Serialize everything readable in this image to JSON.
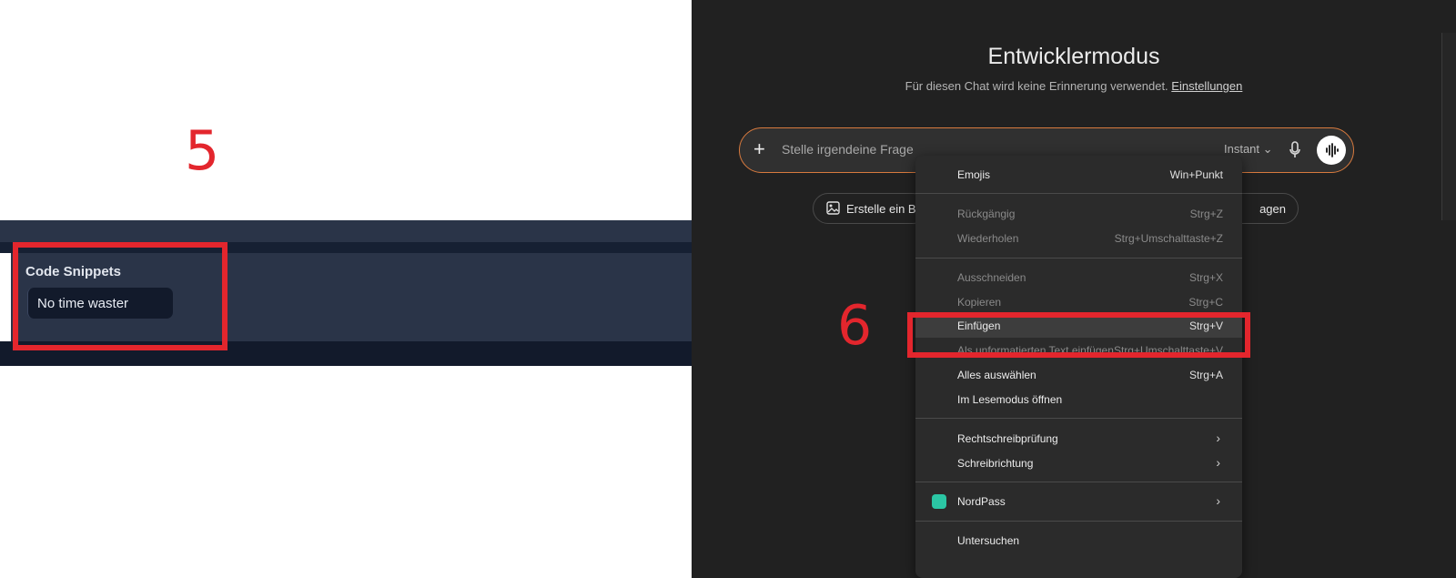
{
  "left": {
    "step_number": "5",
    "section_label": "Code Snippets",
    "snippet_chip": "No time waster"
  },
  "right": {
    "step_number": "6",
    "title": "Entwicklermodus",
    "subtitle": "Für diesen Chat wird keine Erinnerung verwendet.",
    "settings_link": "Einstellungen",
    "prompt": {
      "placeholder": "Stelle irgendeine Frage",
      "model": "Instant"
    },
    "chips": {
      "image": "Erstelle ein Bil",
      "right_partial": "agen"
    },
    "context_menu": {
      "emojis": {
        "label": "Emojis",
        "shortcut": "Win+Punkt"
      },
      "undo": {
        "label": "Rückgängig",
        "shortcut": "Strg+Z"
      },
      "redo": {
        "label": "Wiederholen",
        "shortcut": "Strg+Umschalttaste+Z"
      },
      "cut": {
        "label": "Ausschneiden",
        "shortcut": "Strg+X"
      },
      "copy": {
        "label": "Kopieren",
        "shortcut": "Strg+C"
      },
      "paste": {
        "label": "Einfügen",
        "shortcut": "Strg+V"
      },
      "paste_plain": {
        "label": "Als unformatierten Text einfügen",
        "shortcut": "Strg+Umschalttaste+V"
      },
      "select_all": {
        "label": "Alles auswählen",
        "shortcut": "Strg+A"
      },
      "reader_mode": {
        "label": "Im Lesemodus öffnen"
      },
      "spellcheck": {
        "label": "Rechtschreibprüfung"
      },
      "writing_direction": {
        "label": "Schreibrichtung"
      },
      "nordpass": {
        "label": "NordPass"
      },
      "inspect": {
        "label": "Untersuchen"
      }
    }
  },
  "colors": {
    "annotation_red": "#e3262d",
    "dark_bg": "#212121",
    "navy_panel": "#2a3448",
    "prompt_border": "#d87a3e",
    "nordpass_green": "#2bc6a4"
  }
}
